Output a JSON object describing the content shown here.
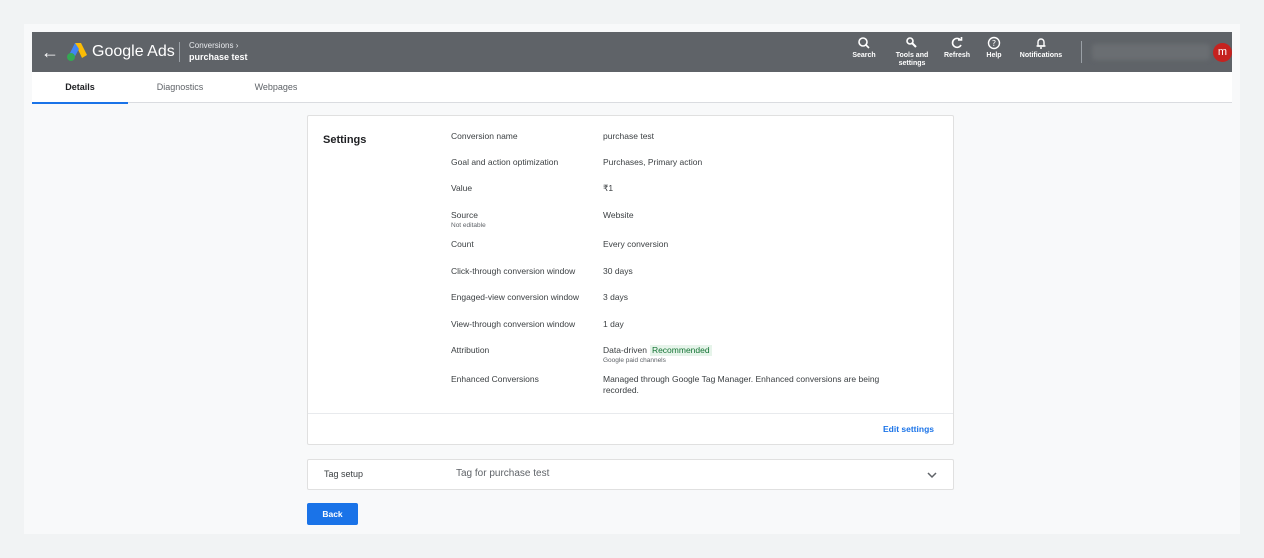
{
  "header": {
    "brand": "Google Ads",
    "breadcrumb_parent": "Conversions",
    "breadcrumb_page": "purchase test",
    "avatar_initial": "m",
    "tools": {
      "search": "Search",
      "tools_settings": "Tools and settings",
      "refresh": "Refresh",
      "help": "Help",
      "notifications": "Notifications"
    }
  },
  "tabs": [
    "Details",
    "Diagnostics",
    "Webpages"
  ],
  "active_tab": "Details",
  "settings": {
    "heading": "Settings",
    "rows": [
      {
        "label": "Conversion name",
        "value": "purchase test"
      },
      {
        "label": "Goal and action optimization",
        "value": "Purchases, Primary action"
      },
      {
        "label": "Value",
        "value": "₹1"
      },
      {
        "label": "Source",
        "sublabel": "Not editable",
        "value": "Website"
      },
      {
        "label": "Count",
        "value": "Every conversion"
      },
      {
        "label": "Click-through conversion window",
        "value": "30 days"
      },
      {
        "label": "Engaged-view conversion window",
        "value": "3 days"
      },
      {
        "label": "View-through conversion window",
        "value": "1 day"
      },
      {
        "label": "Attribution",
        "value": "Data-driven",
        "badge": "Recommended",
        "value_sub": "Google paid channels"
      },
      {
        "label": "Enhanced Conversions",
        "value": "Managed through Google Tag Manager. Enhanced conversions are being recorded."
      }
    ],
    "edit_label": "Edit settings"
  },
  "tag_setup": {
    "title": "Tag setup",
    "description": "Tag for purchase test"
  },
  "back_label": "Back",
  "colors": {
    "topbar": "#5f6368",
    "accent": "#1a73e8",
    "avatar": "#c5221f",
    "badge_bg": "#e6f4ea",
    "badge_text": "#137333"
  }
}
